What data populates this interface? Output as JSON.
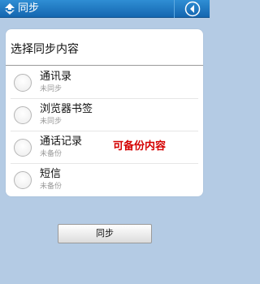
{
  "titlebar": {
    "title": "同步"
  },
  "panel": {
    "title": "选择同步内容",
    "items": [
      {
        "label": "通讯录",
        "status": "未同步"
      },
      {
        "label": "浏览器书签",
        "status": "未同步"
      },
      {
        "label": "通话记录",
        "status": "未备份"
      },
      {
        "label": "短信",
        "status": "未备份"
      }
    ]
  },
  "annotation": "可备份内容",
  "footer": {
    "sync_button_label": "同步"
  },
  "colors": {
    "titlebar": "#1a72bd",
    "background": "#b4cbe4",
    "annotation": "#d40000"
  },
  "icons": {
    "app": "sync-app-icon",
    "back": "back-arrow-icon"
  }
}
